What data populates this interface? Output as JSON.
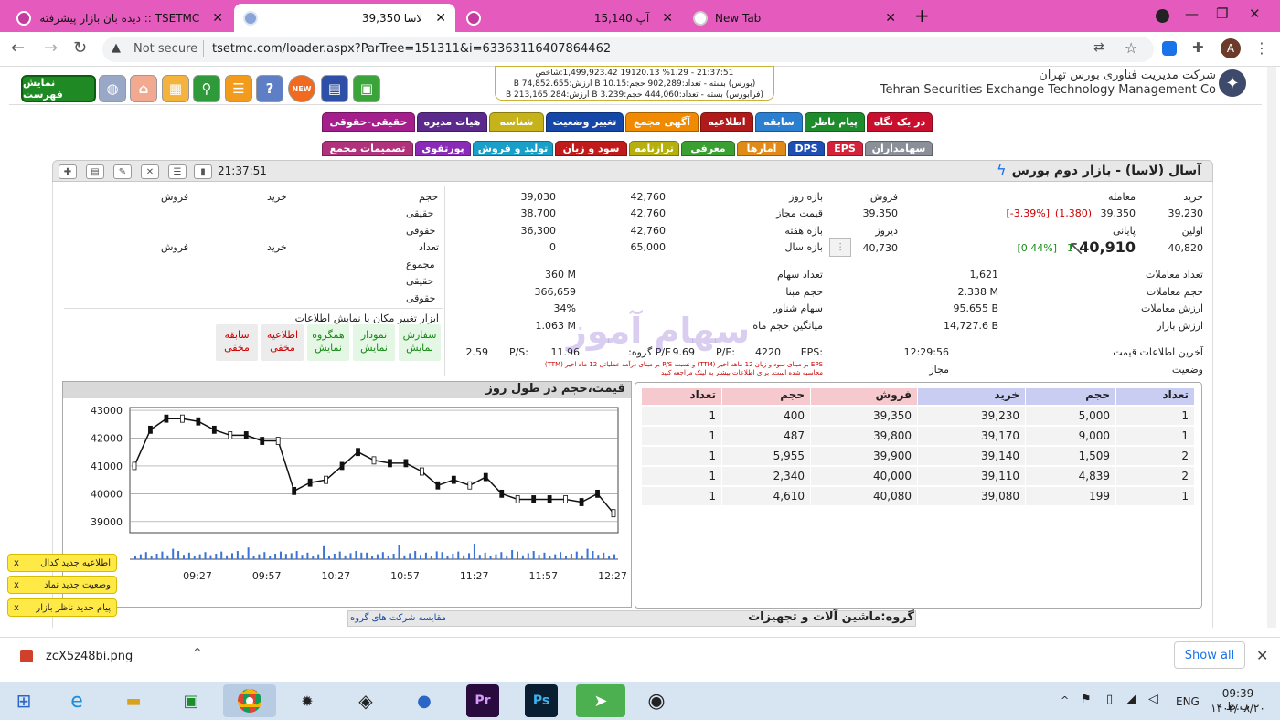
{
  "browser": {
    "tabs": [
      {
        "label": "دیده بان بازار پیشرفته :: TSETMC",
        "active": false
      },
      {
        "label": "لاسا 39,350",
        "active": true
      },
      {
        "label": "آپ 15,140",
        "active": false
      },
      {
        "label": "New Tab",
        "active": false
      }
    ],
    "new_tab": "+",
    "security": "Not secure",
    "url": "tsetmc.com/loader.aspx?ParTree=151311&i=63363116407864462",
    "profile": "A"
  },
  "banner": {
    "fast_button": "نمایش فهرست",
    "new_badge": "NEW",
    "index_lines": [
      "21:37:51 - %1.29 19120.13 1,499,923.42:شاخص",
      "(بورس) بسته - تعداد:902,289 حجم:10.15 B ارزش:74,852.655 B",
      "(فرابورس) بسته - تعداد:444,060 حجم:3.239 B ارزش:213,165.284 B"
    ],
    "company_fa": "شرکت مدیریت فناوری بورس تهران",
    "company_en": "Tehran Securities Exchange Technology Management Co"
  },
  "menu_row1": [
    {
      "label": "در یک نگاه",
      "color": "#c8102e"
    },
    {
      "label": "پیام ناظر",
      "color": "#1e8b2c"
    },
    {
      "label": "سابقه",
      "color": "#2a7fd1"
    },
    {
      "label": "اطلاعیه",
      "color": "#b01a1a"
    },
    {
      "label": "آگهی مجمع",
      "color": "#f08a00"
    },
    {
      "label": "تغییر وضعیت",
      "color": "#1447a8"
    },
    {
      "label": "شناسه",
      "color": "#c6b21a"
    },
    {
      "label": "هیات مدیره",
      "color": "#5b2a8c"
    },
    {
      "label": "حقیقی-حقوقی",
      "color": "#a51f8c"
    }
  ],
  "menu_row2": [
    {
      "label": "سهامداران",
      "color": "#8a8f98"
    },
    {
      "label": "EPS",
      "color": "#d3223a"
    },
    {
      "label": "DPS",
      "color": "#1e4fb3"
    },
    {
      "label": "آمارها",
      "color": "#e08a1a"
    },
    {
      "label": "معرفی",
      "color": "#3aa032"
    },
    {
      "label": "ترازنامه",
      "color": "#b5b010"
    },
    {
      "label": "سود و زیان",
      "color": "#c01a1a"
    },
    {
      "label": "تولید و فروش",
      "color": "#1aa0c8"
    },
    {
      "label": "پورتفوی",
      "color": "#8a2bb8"
    },
    {
      "label": "تصمیمات مجمع",
      "color": "#b0327a"
    }
  ],
  "panel": {
    "symbol_title": "آسال (لاسا) - بازار دوم بورس",
    "time": "21:37:51"
  },
  "summary": {
    "labels": {
      "buy": "خرید",
      "trade": "معامله",
      "sell": "فروش",
      "first": "اولین",
      "final": "پایانی",
      "yesterday": "دیروز"
    },
    "buy": "39,230",
    "trade_price": "39,350",
    "trade_change": "(1,380)",
    "trade_pct": "[-3.39%]",
    "sell": "39,350",
    "first": "40,820",
    "final_big": "40,910",
    "final_prefix": "1",
    "final_pct": "[0.44%]",
    "yesterday": "40,730"
  },
  "ranges": [
    {
      "label": "بازه روز",
      "high": "42,760",
      "low": "39,030"
    },
    {
      "label": "قیمت مجاز",
      "high": "42,760",
      "low": "38,700"
    },
    {
      "label": "بازه هفته",
      "high": "42,760",
      "low": "36,300"
    },
    {
      "label": "بازه سال",
      "high": "65,000",
      "low": "0"
    }
  ],
  "stats_left": [
    {
      "label": "تعداد معاملات",
      "value": "1,621"
    },
    {
      "label": "حجم معاملات",
      "value": "2.338 M"
    },
    {
      "label": "ارزش معاملات",
      "value": "95.655 B"
    },
    {
      "label": "ارزش بازار",
      "value": "14,727.6 B"
    }
  ],
  "stats_right": [
    {
      "label": "تعداد سهام",
      "value": "360 M"
    },
    {
      "label": "حجم مبنا",
      "value": "366,659"
    },
    {
      "label": "سهام شناور",
      "value": "34%"
    },
    {
      "label": "میانگین حجم ماه",
      "value": "1.063 M"
    }
  ],
  "investor": {
    "col_volume": "حجم",
    "col_buy": "خرید",
    "col_sell": "فروش",
    "col_count": "تعداد",
    "real": "حقیقی",
    "legal": "حقوقی",
    "total": "مجموع"
  },
  "ratios": {
    "eps_label": "EPS:",
    "eps": "4220",
    "pe_label": "P/E:",
    "pe": "9.69",
    "gpe_label": "P/E گروه:",
    "gpe": "11.96",
    "ps_label": "P/S:",
    "ps": "2.59",
    "note1": "EPS بر مبنای سود و زیان 12 ماهه اخیر (TTM) و نسبت P/S بر مبنای درآمد عملیاتی 12 ماه اخیر (TTM)",
    "note2": "محاسبه شده است. برای اطلاعات بیشتر به لینک مراجعه کنید"
  },
  "status": {
    "last_label": "آخرین اطلاعات قیمت",
    "last_value": "12:29:56",
    "state_label": "وضعیت",
    "state_value": "مجاز"
  },
  "tools": {
    "caption": "ابزار تغییر مکان یا نمایش اطلاعات",
    "buttons": [
      {
        "l1": "سفارش",
        "l2": "نمایش",
        "green": true
      },
      {
        "l1": "نمودار",
        "l2": "نمایش",
        "green": true
      },
      {
        "l1": "همگروه",
        "l2": "نمایش",
        "green": true
      },
      {
        "l1": "اطلاعیه",
        "l2": "مخفی",
        "green": false
      },
      {
        "l1": "سابقه",
        "l2": "مخفی",
        "green": false
      }
    ]
  },
  "watermark": "سهام آموز",
  "chart_data": {
    "type": "line",
    "title": "قیمت،حجم در طول روز",
    "x": [
      "09:27",
      "09:57",
      "10:27",
      "10:57",
      "11:27",
      "11:57",
      "12:27"
    ],
    "ylim": [
      38600,
      43100
    ],
    "y_ticks": [
      "43000",
      "42000",
      "41000",
      "40000",
      "39000"
    ],
    "series": [
      {
        "values": [
          41000,
          42300,
          42700,
          42700,
          42600,
          42300,
          42100,
          42100,
          41900,
          41900,
          40100,
          40400,
          40500,
          41000,
          41500,
          41200,
          41100,
          41100,
          40800,
          40300,
          40500,
          40300,
          40600,
          40000,
          39800,
          39800,
          39800,
          39800,
          39700,
          40000,
          39300
        ]
      }
    ]
  },
  "orderbook": {
    "headers": [
      "تعداد",
      "حجم",
      "خرید",
      "فروش",
      "حجم",
      "تعداد"
    ],
    "rows": [
      [
        "1",
        "5,000",
        "39,230",
        "39,350",
        "400",
        "1"
      ],
      [
        "1",
        "9,000",
        "39,170",
        "39,800",
        "487",
        "1"
      ],
      [
        "2",
        "1,509",
        "39,140",
        "39,900",
        "5,955",
        "1"
      ],
      [
        "2",
        "4,839",
        "39,110",
        "40,000",
        "2,340",
        "1"
      ],
      [
        "1",
        "199",
        "39,080",
        "40,080",
        "4,610",
        "1"
      ]
    ]
  },
  "notifications": [
    "اطلاعیه جدید کدال",
    "وضعیت جدید نماد",
    "پیام جدید ناظر بازار"
  ],
  "notif_close": "x",
  "group": {
    "label": "گروه:ماشین آلات و تجهیزات",
    "link": "مقایسه شرکت های گروه"
  },
  "download": {
    "file": "zcX5z48bi.png",
    "show_all": "Show all"
  },
  "taskbar": {
    "lang": "ENG",
    "time": "09:39 ب.ظ",
    "date": "۱۴۰۲/۰۸/۲۰"
  },
  "colors": {
    "tabstrip": "#e45bbd",
    "buy_header": "#c9cdf2",
    "sell_header": "#f6c9cf"
  }
}
